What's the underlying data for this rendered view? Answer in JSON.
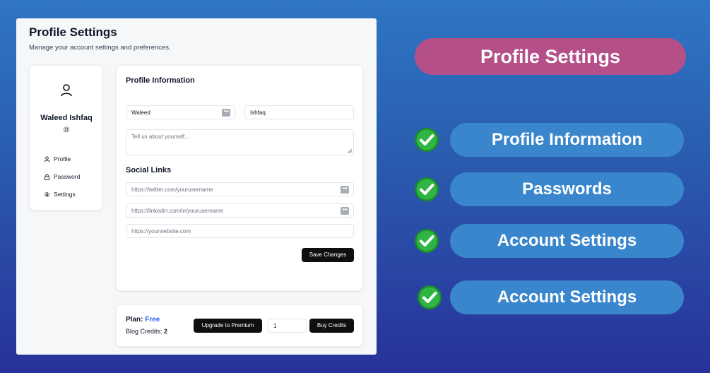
{
  "app": {
    "title": "Profile Settings",
    "subtitle": "Manage your account settings and preferences."
  },
  "sidebar": {
    "user_name": "Waleed Ishfaq",
    "user_handle": "@",
    "items": [
      {
        "label": "Profile",
        "icon": "user-icon"
      },
      {
        "label": "Password",
        "icon": "lock-icon"
      },
      {
        "label": "Settings",
        "icon": "gear-icon"
      }
    ]
  },
  "profile_info": {
    "title": "Profile Information",
    "first_name": "Waleed",
    "last_name": "Ishfaq",
    "bio_placeholder": "Tell us about yourself..."
  },
  "social_links": {
    "title": "Social Links",
    "twitter_placeholder": "https://twitter.com/yourusername",
    "linkedin_placeholder": "https://linkedin.com/in/yourusername",
    "website_placeholder": "https://yourwebsite.com"
  },
  "save_button": "Save Changes",
  "plan": {
    "label": "Plan:",
    "value": "Free",
    "credits_label": "Blog Credits:",
    "credits_value": "2",
    "upgrade_button": "Upgrade to Premium",
    "quantity": "1",
    "buy_button": "Buy Credits"
  },
  "features": {
    "heading": "Profile Settings",
    "items": [
      "Profile Information",
      "Passwords",
      "Account Settings",
      "Account Settings"
    ]
  },
  "colors": {
    "heading_pill": "#b44f88",
    "feature_pill": "#3a86cc",
    "check": "#22a534",
    "plan_value": "#2563eb"
  }
}
